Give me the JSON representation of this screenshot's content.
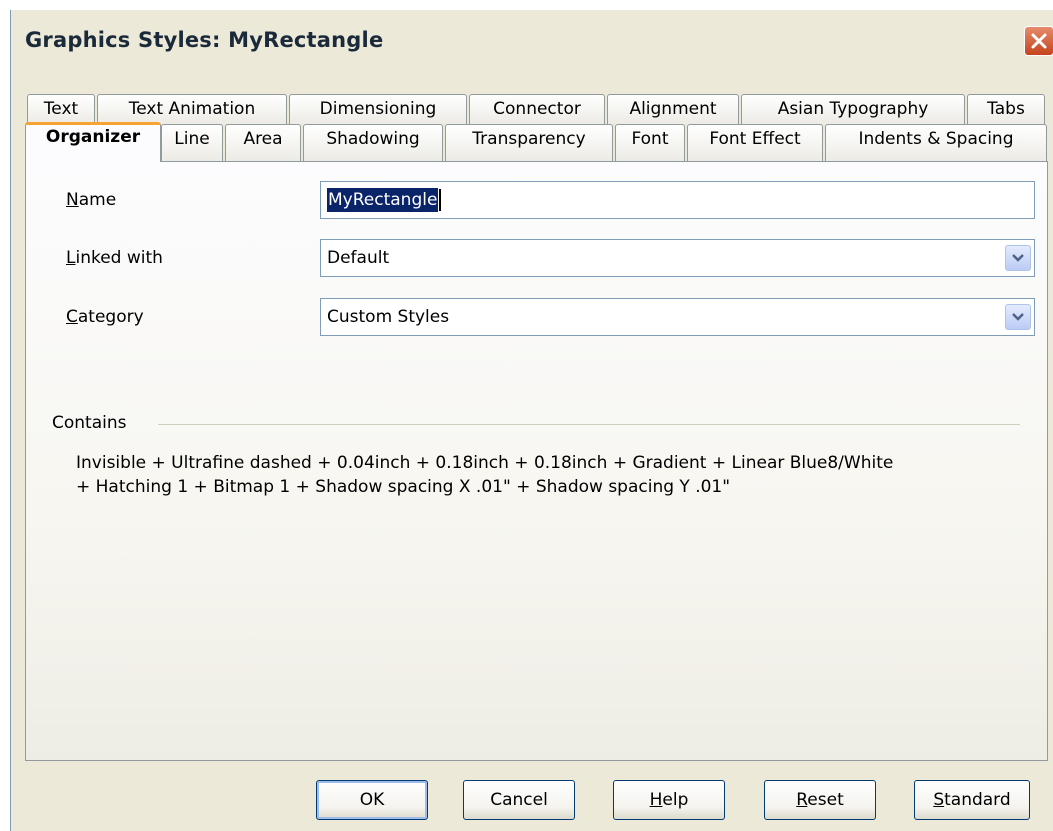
{
  "window": {
    "title": "Graphics Styles: MyRectangle"
  },
  "tabs": {
    "row1": [
      "Text",
      "Text Animation",
      "Dimensioning",
      "Connector",
      "Alignment",
      "Asian Typography",
      "Tabs"
    ],
    "row2": [
      "Organizer",
      "Line",
      "Area",
      "Shadowing",
      "Transparency",
      "Font",
      "Font Effect",
      "Indents & Spacing"
    ],
    "active": "Organizer"
  },
  "form": {
    "name_label": "Name",
    "name_value": "MyRectangle",
    "linked_label": "Linked with",
    "linked_value": "Default",
    "category_label": "Category",
    "category_value": "Custom Styles"
  },
  "contains": {
    "label": "Contains",
    "line1": "Invisible + Ultrafine dashed + 0.04inch + 0.18inch + 0.18inch + Gradient + Linear Blue8/White",
    "line2": "+ Hatching 1 + Bitmap 1 + Shadow spacing X .01\" + Shadow spacing Y .01\""
  },
  "buttons": {
    "ok": "OK",
    "cancel": "Cancel",
    "help": "Help",
    "reset": "Reset",
    "standard": "Standard"
  },
  "icons": {
    "close": "close-icon",
    "dropdown": "chevron-down-icon"
  },
  "colors": {
    "dialog_bg": "#ece9d8",
    "close_button": "#c4441c",
    "active_tab_accent": "#f5a433",
    "selection": "#0a246a"
  }
}
